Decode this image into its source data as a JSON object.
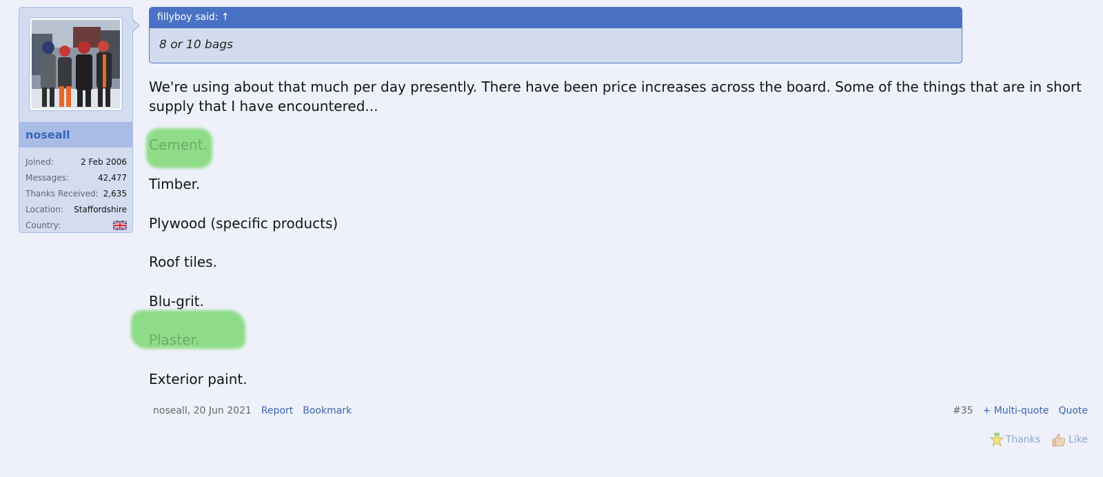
{
  "author": {
    "username": "noseall",
    "stats": [
      {
        "label": "Joined:",
        "value": "2 Feb 2006"
      },
      {
        "label": "Messages:",
        "value": "42,477"
      },
      {
        "label": "Thanks Received:",
        "value": "2,635"
      },
      {
        "label": "Location:",
        "value": "Staffordshire"
      },
      {
        "label": "Country:",
        "value": ""
      }
    ],
    "country_flag_icon": "uk-flag-icon"
  },
  "quote": {
    "header": "fillyboy said: ↑",
    "text": "8 or 10 bags"
  },
  "message": {
    "intro": "We're using about that much per day presently. There have been price increases across the board. Some of the things that are in short supply that I have encountered...",
    "items": [
      "Cement.",
      "Timber.",
      "Plywood (specific products)",
      "Roof tiles.",
      "Blu-grit.",
      "Plaster.",
      "Exterior paint."
    ]
  },
  "footer": {
    "byline": "noseall, 20 Jun 2021",
    "report": "Report",
    "bookmark": "Bookmark",
    "post_number": "#35",
    "multiquote": "+ Multi-quote",
    "quote": "Quote",
    "thanks": "Thanks",
    "like": "Like"
  },
  "colors": {
    "accent": "#4a72c4",
    "highlight": "#8fdc88",
    "background": "#eef1fa"
  }
}
